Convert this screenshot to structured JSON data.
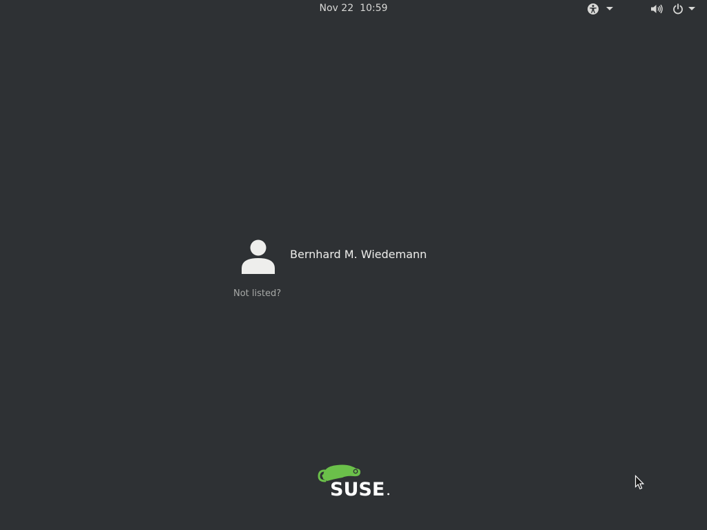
{
  "topbar": {
    "date": "Nov 22",
    "time": "10:59",
    "accessibility_icon": "accessibility-icon",
    "volume_icon": "volume-icon",
    "power_icon": "power-icon"
  },
  "login": {
    "user_name": "Bernhard M. Wiedemann",
    "avatar_icon": "user-avatar-icon",
    "not_listed": "Not listed?"
  },
  "logo": {
    "text": "SUSE",
    "brand_color": "#6bc04a"
  },
  "colors": {
    "background": "#2e3134",
    "text": "#eeeeec",
    "muted_text": "#a7a9a7"
  }
}
